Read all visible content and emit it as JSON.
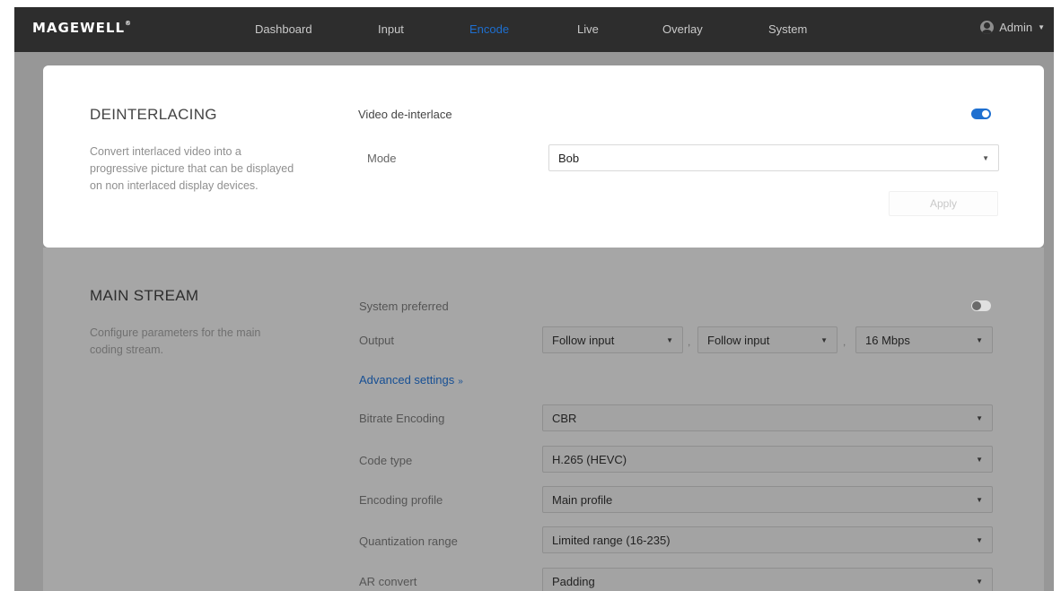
{
  "navbar": {
    "logo": "MAGEWELL",
    "items": [
      {
        "label": "Dashboard"
      },
      {
        "label": "Input"
      },
      {
        "label": "Encode"
      },
      {
        "label": "Live"
      },
      {
        "label": "Overlay"
      },
      {
        "label": "System"
      }
    ],
    "active": "Encode",
    "user": "Admin"
  },
  "deinterlacing": {
    "title": "DEINTERLACING",
    "description": "Convert interlaced video into a progressive picture that can be displayed on non interlaced display devices.",
    "toggle_label": "Video de-interlace",
    "toggle_on": true,
    "mode_label": "Mode",
    "mode_value": "Bob",
    "apply_label": "Apply"
  },
  "main_stream": {
    "title": "MAIN STREAM",
    "description": "Configure parameters for the main coding stream.",
    "system_preferred_label": "System preferred",
    "system_preferred_on": false,
    "output_label": "Output",
    "output_resolution": "Follow input",
    "output_framerate": "Follow input",
    "output_bitrate": "16 Mbps",
    "separator": ",",
    "advanced_label": "Advanced settings",
    "bitrate_encoding_label": "Bitrate Encoding",
    "bitrate_encoding_value": "CBR",
    "code_type_label": "Code type",
    "code_type_value": "H.265 (HEVC)",
    "encoding_profile_label": "Encoding profile",
    "encoding_profile_value": "Main profile",
    "quantization_label": "Quantization range",
    "quantization_value": "Limited range (16-235)",
    "ar_convert_label": "AR convert",
    "ar_convert_value": "Padding"
  },
  "colors": {
    "accent": "#1e6fd0",
    "navbar": "#2d2d2d",
    "overlay": "#979797"
  },
  "icons": {
    "user": "user-icon",
    "dropdown": "chevron-down-icon",
    "advanced": "double-chevron-down-icon"
  }
}
